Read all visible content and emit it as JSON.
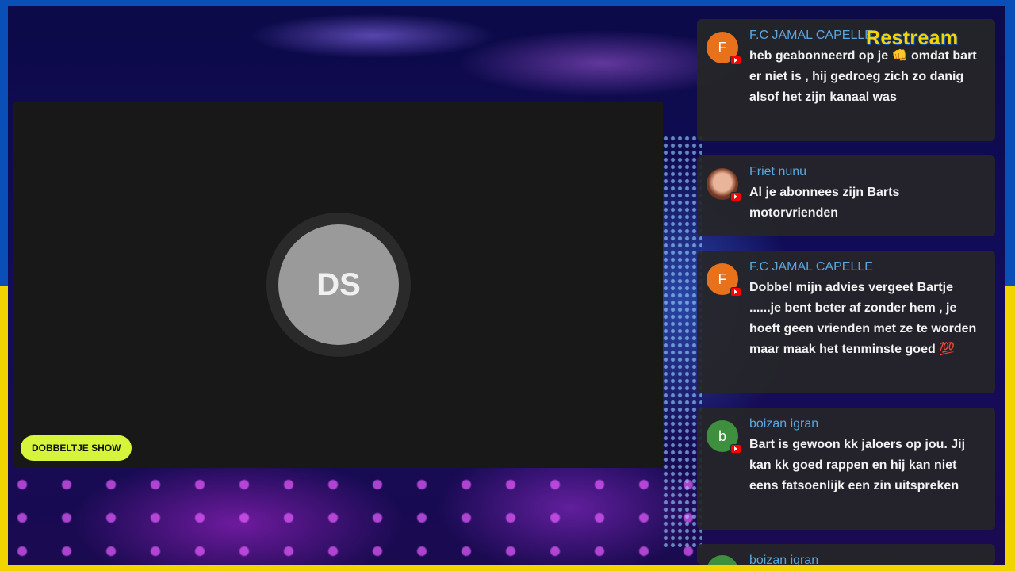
{
  "stage": {
    "brand": "Restream",
    "avatar_initials": "DS",
    "show_name": "DOBBELTJE SHOW"
  },
  "chat": [
    {
      "avatar_letter": "F",
      "avatar_color": "#e8721c",
      "author": "F.C JAMAL CAPELLE",
      "text": "heb geabonneerd op je 👊 omdat bart er niet is , hij gedroeg zich zo danig alsof het zijn kanaal was"
    },
    {
      "avatar_letter": "",
      "avatar_color": "photo",
      "author": "Friet nunu",
      "text": "Al je abonnees zijn Barts motorvrienden"
    },
    {
      "avatar_letter": "F",
      "avatar_color": "#e8721c",
      "author": "F.C JAMAL CAPELLE",
      "text": "Dobbel mijn advies vergeet Bartje ......je bent beter af zonder hem , je hoeft geen vrienden met ze te worden maar maak het tenminste goed 💯"
    },
    {
      "avatar_letter": "b",
      "avatar_color": "#3e8f3e",
      "author": "boizan igran",
      "text": "Bart is gewoon kk jaloers op jou. Jij kan kk goed rappen en hij kan niet eens fatsoenlijk een zin uitspreken"
    },
    {
      "avatar_letter": "b",
      "avatar_color": "#3e8f3e",
      "author": "boizan igran",
      "text": ""
    }
  ],
  "colors": {
    "border_blue": "#0a4fb8",
    "border_yellow": "#f2d500",
    "badge_green": "#d6f53a",
    "author_blue": "#5aa7e0"
  }
}
